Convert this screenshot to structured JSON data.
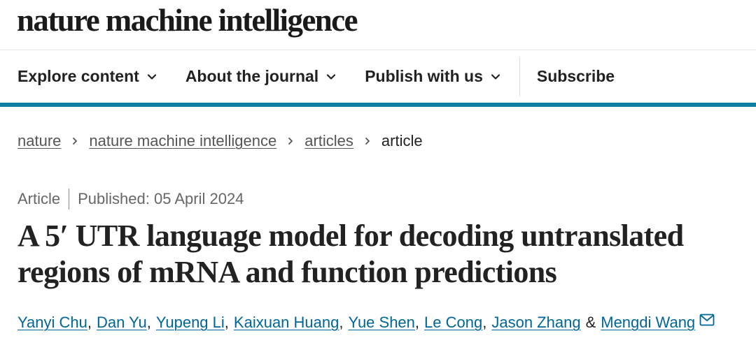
{
  "brand": {
    "logo_text": "nature machine intelligence"
  },
  "nav": {
    "items": [
      {
        "label": "Explore content",
        "icon": "chevron-down-icon"
      },
      {
        "label": "About the journal",
        "icon": "chevron-down-icon"
      },
      {
        "label": "Publish with us",
        "icon": "chevron-down-icon"
      }
    ],
    "subscribe_label": "Subscribe"
  },
  "breadcrumb": {
    "items": [
      "nature",
      "nature machine intelligence",
      "articles"
    ],
    "current": "article",
    "separator_icon": "chevron-right-icon"
  },
  "article": {
    "type": "Article",
    "published": "Published: 05 April 2024",
    "title": "A 5′ UTR language model for decoding untranslated regions of mRNA and function predictions",
    "authors": [
      "Yanyi Chu",
      "Dan Yu",
      "Yupeng Li",
      "Kaixuan Huang",
      "Yue Shen",
      "Le Cong",
      "Jason Zhang",
      "Mengdi Wang"
    ],
    "author_separator": ",",
    "author_conjunction": "&",
    "contact_icon": "mail-icon"
  },
  "colors": {
    "accent": "#0f7f9f",
    "link": "#006699",
    "text": "#222222",
    "muted": "#666666"
  }
}
